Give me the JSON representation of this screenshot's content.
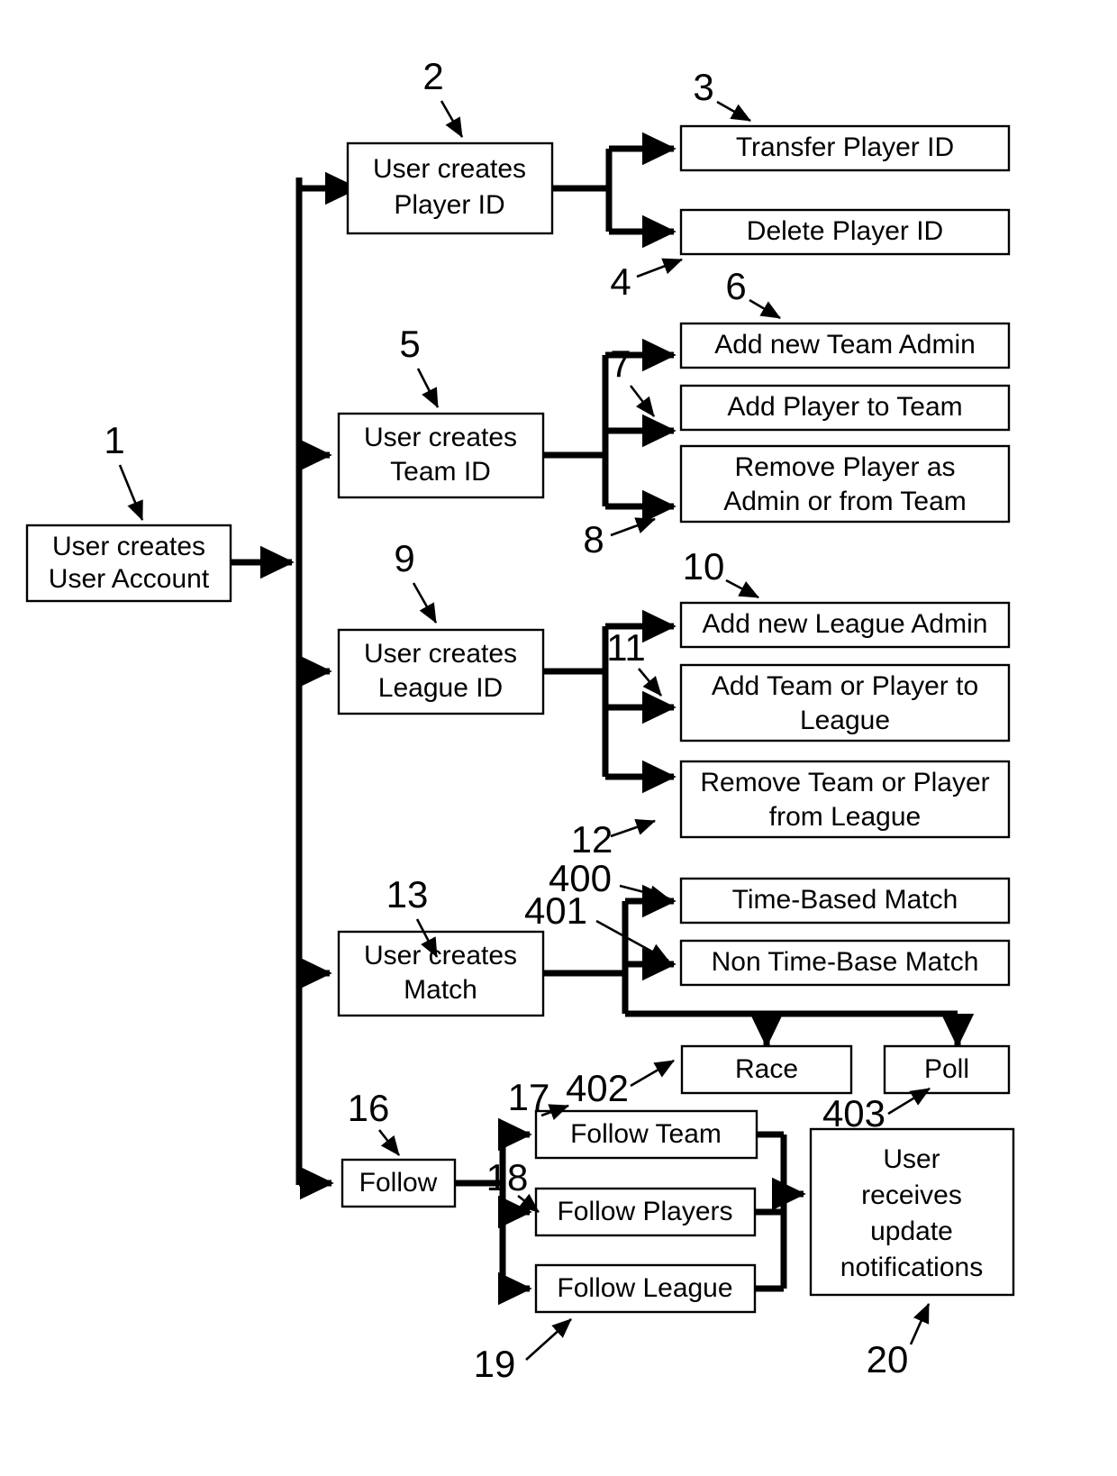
{
  "figure": {
    "type": "patent-flowchart",
    "orientation": "left-to-right tree"
  },
  "boxes": [
    {
      "id": "user-account",
      "label_lines": [
        "User creates",
        "User Account"
      ],
      "ref": "1"
    },
    {
      "id": "player-id",
      "label_lines": [
        "User creates",
        "Player ID"
      ],
      "ref": "2"
    },
    {
      "id": "transfer-player-id",
      "label_lines": [
        "Transfer Player ID"
      ],
      "ref": "3"
    },
    {
      "id": "delete-player-id",
      "label_lines": [
        "Delete Player ID"
      ],
      "ref": "4"
    },
    {
      "id": "team-id",
      "label_lines": [
        "User creates",
        "Team ID"
      ],
      "ref": "5"
    },
    {
      "id": "add-team-admin",
      "label_lines": [
        "Add new Team Admin"
      ],
      "ref": "6"
    },
    {
      "id": "add-player-to-team",
      "label_lines": [
        "Add Player to Team"
      ],
      "ref": "7"
    },
    {
      "id": "remove-player",
      "label_lines": [
        "Remove Player as",
        "Admin or from Team"
      ],
      "ref": "8"
    },
    {
      "id": "league-id",
      "label_lines": [
        "User creates",
        "League ID"
      ],
      "ref": "9"
    },
    {
      "id": "add-league-admin",
      "label_lines": [
        "Add new League Admin"
      ],
      "ref": "10"
    },
    {
      "id": "add-team-to-league",
      "label_lines": [
        "Add Team or Player to",
        "League"
      ],
      "ref": "11"
    },
    {
      "id": "remove-from-league",
      "label_lines": [
        "Remove Team or Player",
        "from League"
      ],
      "ref": "12"
    },
    {
      "id": "create-match",
      "label_lines": [
        "User creates",
        "Match"
      ],
      "ref": "13"
    },
    {
      "id": "time-based-match",
      "label_lines": [
        "Time-Based Match"
      ],
      "ref": "400"
    },
    {
      "id": "non-time-base-match",
      "label_lines": [
        "Non Time-Base Match"
      ],
      "ref": "401"
    },
    {
      "id": "race",
      "label_lines": [
        "Race"
      ],
      "ref": "402"
    },
    {
      "id": "poll",
      "label_lines": [
        "Poll"
      ],
      "ref": "403"
    },
    {
      "id": "follow",
      "label_lines": [
        "Follow"
      ],
      "ref": "16"
    },
    {
      "id": "follow-team",
      "label_lines": [
        "Follow Team"
      ],
      "ref": "17"
    },
    {
      "id": "follow-players",
      "label_lines": [
        "Follow Players"
      ],
      "ref": "18"
    },
    {
      "id": "follow-league",
      "label_lines": [
        "Follow League"
      ],
      "ref": "19"
    },
    {
      "id": "update-notifications",
      "label_lines": [
        "User",
        "receives",
        "update",
        "notifications"
      ],
      "ref": "20"
    }
  ],
  "labels": {
    "user_account_l1": "User creates",
    "user_account_l2": "User Account",
    "player_id_l1": "User creates",
    "player_id_l2": "Player ID",
    "transfer_player_id": "Transfer Player ID",
    "delete_player_id": "Delete Player ID",
    "team_id_l1": "User creates",
    "team_id_l2": "Team ID",
    "add_team_admin": "Add new Team Admin",
    "add_player_to_team": "Add Player to Team",
    "remove_player_l1": "Remove Player as",
    "remove_player_l2": "Admin or from Team",
    "league_id_l1": "User creates",
    "league_id_l2": "League ID",
    "add_league_admin": "Add new League Admin",
    "add_team_to_league_l1": "Add Team or Player to",
    "add_team_to_league_l2": "League",
    "remove_from_league_l1": "Remove Team or Player",
    "remove_from_league_l2": "from League",
    "create_match_l1": "User creates",
    "create_match_l2": "Match",
    "time_based_match": "Time-Based Match",
    "non_time_base_match": "Non Time-Base Match",
    "race": "Race",
    "poll": "Poll",
    "follow": "Follow",
    "follow_team": "Follow Team",
    "follow_players": "Follow Players",
    "follow_league": "Follow League",
    "notifications_l1": "User",
    "notifications_l2": "receives",
    "notifications_l3": "update",
    "notifications_l4": "notifications"
  },
  "refs": {
    "n1": "1",
    "n2": "2",
    "n3": "3",
    "n4": "4",
    "n5": "5",
    "n6": "6",
    "n7": "7",
    "n8": "8",
    "n9": "9",
    "n10": "10",
    "n11": "11",
    "n12": "12",
    "n13": "13",
    "n16": "16",
    "n17": "17",
    "n18": "18",
    "n19": "19",
    "n20": "20",
    "n400": "400",
    "n401": "401",
    "n402": "402",
    "n403": "403"
  },
  "colors": {
    "stroke": "#000000",
    "fill": "#ffffff",
    "background": "#ffffff"
  }
}
